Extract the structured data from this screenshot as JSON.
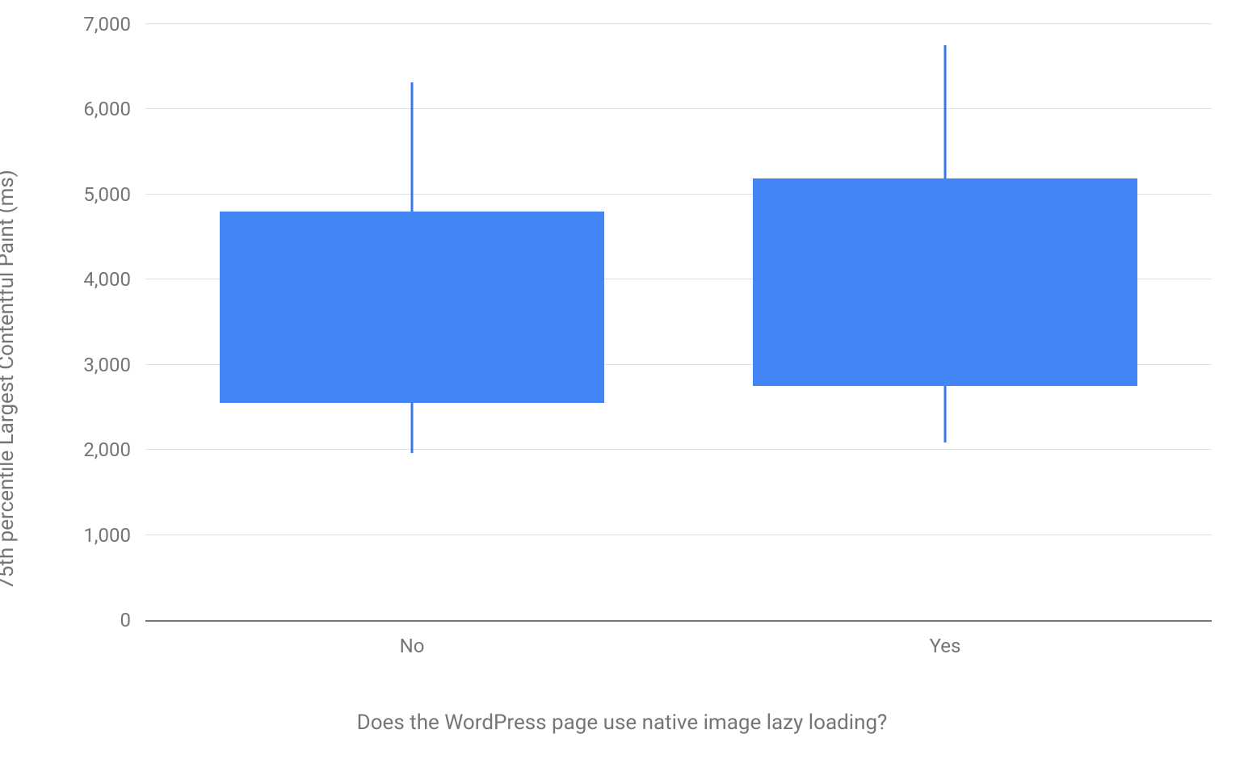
{
  "chart_data": {
    "type": "boxplot",
    "ylabel": "75th percentile Largest Contentful Paint (ms)",
    "xlabel": "Does the WordPress page use native image lazy loading?",
    "ylim": [
      0,
      7000
    ],
    "y_ticks": [
      0,
      1000,
      2000,
      3000,
      4000,
      5000,
      6000,
      7000
    ],
    "y_tick_labels": [
      "0",
      "1,000",
      "2,000",
      "3,000",
      "4,000",
      "5,000",
      "6,000",
      "7,000"
    ],
    "categories": [
      "No",
      "Yes"
    ],
    "series": [
      {
        "name": "No",
        "low": 1960,
        "q1": 2550,
        "q3": 4800,
        "high": 6320
      },
      {
        "name": "Yes",
        "low": 2090,
        "q1": 2750,
        "q3": 5190,
        "high": 6750
      }
    ],
    "box_color": "#4285f4",
    "whisker_color": "#3b78e7"
  }
}
